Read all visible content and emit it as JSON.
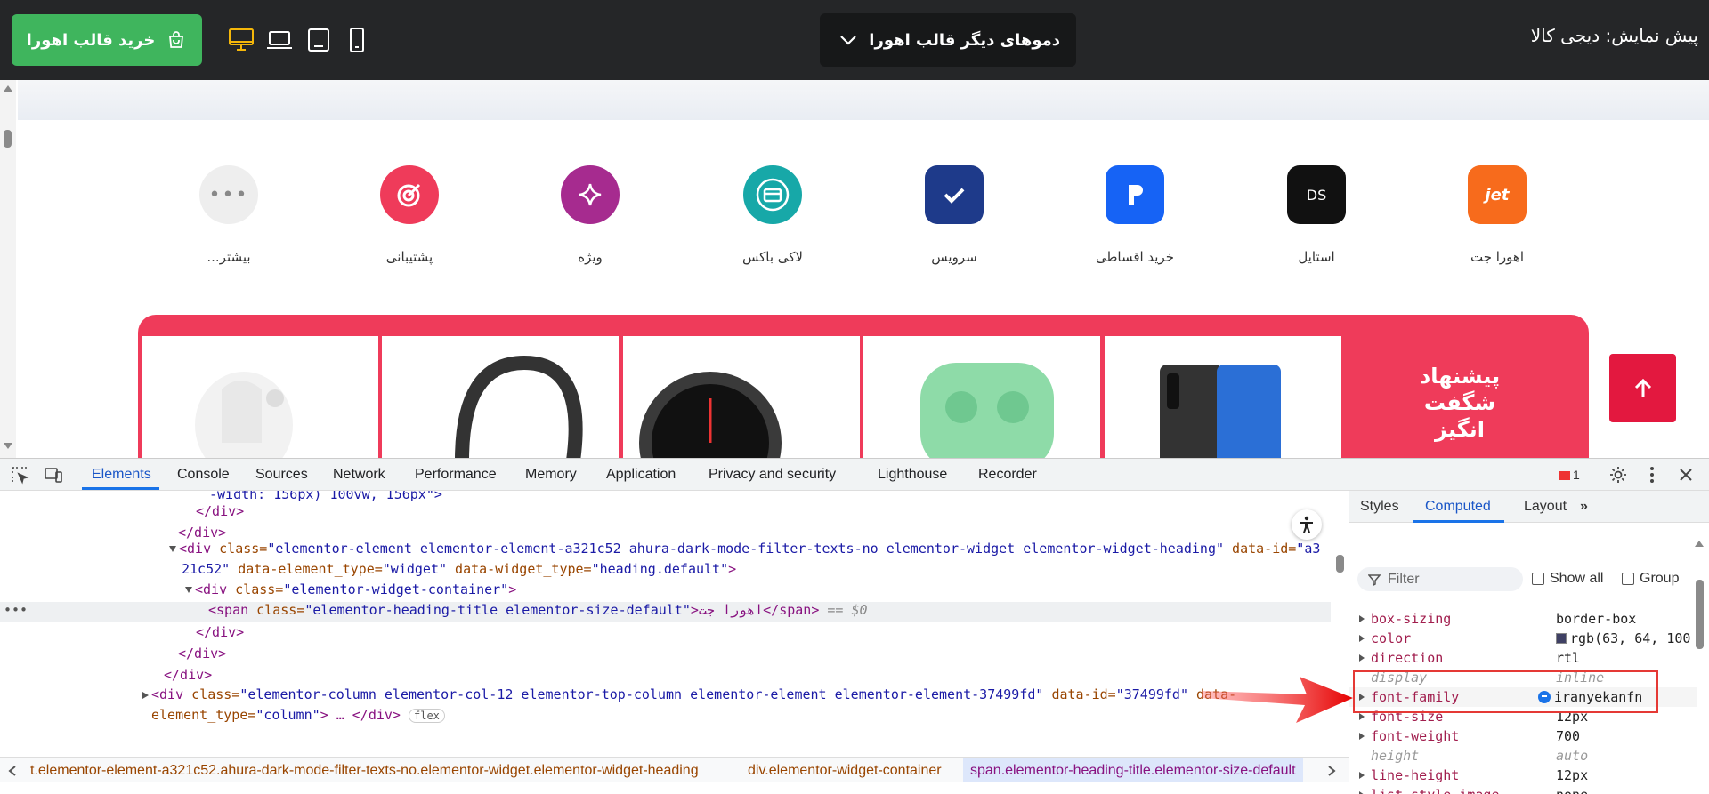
{
  "topbar": {
    "buy_button": "خرید قالب اهورا",
    "demo_select": "دموهای دیگر قالب اهورا",
    "preview_title": "پیش نمایش: دیجی کالا",
    "active_device": "desktop",
    "accent_color": "#3fb55d",
    "active_device_color": "#f5b70a"
  },
  "categories": [
    {
      "label": "اهورا جت",
      "icon": "jet-icon",
      "color": "#f76b1c",
      "text": "jet"
    },
    {
      "label": "استایل",
      "icon": "ds-style-icon",
      "color": "#111111",
      "text": "DS"
    },
    {
      "label": "خرید اقساطی",
      "icon": "installment-icon",
      "color": "#1663f5"
    },
    {
      "label": "سرویس",
      "icon": "check-icon",
      "color": "#1e3a8a"
    },
    {
      "label": "لاکی باکس",
      "icon": "lucky-box-icon",
      "color": "#17a8a8"
    },
    {
      "label": "ویژه",
      "icon": "sparkle-icon",
      "color": "#a62b8f"
    },
    {
      "label": "پشتیبانی",
      "icon": "target-icon",
      "color": "#ef3b5a"
    },
    {
      "label": "بیشتر...",
      "icon": "more-icon",
      "color": "#eeeeee"
    }
  ],
  "deal": {
    "title_lines": [
      "پیشنهاد",
      "شگفت",
      "انگیز"
    ],
    "color": "#ef3b5a"
  },
  "devtools": {
    "tabs": [
      "Elements",
      "Console",
      "Sources",
      "Network",
      "Performance",
      "Memory",
      "Application",
      "Privacy and security",
      "Lighthouse",
      "Recorder"
    ],
    "active_tab": "Elements",
    "error_count": "1",
    "dom": {
      "l1": "-width: 156px) 100vw, 156px\">",
      "l2": "</div>",
      "l3": "</div>",
      "l4_tag": "<div",
      "l4_attr1": " class=",
      "l4_val1": "\"elementor-element elementor-element-a321c52 ahura-dark-mode-filter-texts-no elementor-widget elementor-widget-heading\"",
      "l4_attr2": " data-id=",
      "l4_val2": "\"a3",
      "l5_val2": "21c52\"",
      "l5_attr3": " data-element_type=",
      "l5_val3": "\"widget\"",
      "l5_attr4": " data-widget_type=",
      "l5_val4": "\"heading.default\"",
      "l5_end": ">",
      "l6_tag": "<div",
      "l6_attr": " class=",
      "l6_val": "\"elementor-widget-container\"",
      "l6_end": ">",
      "l7_tag": "<span",
      "l7_attr": " class=",
      "l7_val": "\"elementor-heading-title elementor-size-default\"",
      "l7_text": ">اهورا جت</span>",
      "l7_marker": "== $0",
      "l8": "</div>",
      "l9": "</div>",
      "l10": "</div>",
      "l11_tag": "<div",
      "l11_attr1": " class=",
      "l11_val1": "\"elementor-column elementor-col-12 elementor-top-column elementor-element elementor-element-37499fd\"",
      "l11_attr2": " data-id=",
      "l11_val2": "\"37499fd\"",
      "l11_attr3": " data-",
      "l12_attr": "element_type=",
      "l12_val": "\"column\"",
      "l12_end": "> … </div>",
      "l12_badge": "flex"
    },
    "breadcrumbs": [
      "t.elementor-element-a321c52.ahura-dark-mode-filter-texts-no.elementor-widget.elementor-widget-heading",
      "div.elementor-widget-container",
      "span.elementor-heading-title.elementor-size-default"
    ],
    "side_tabs": [
      "Styles",
      "Computed",
      "Layout"
    ],
    "side_active": "Computed",
    "filter_placeholder": "Filter",
    "show_all": "Show all",
    "group": "Group",
    "props": [
      {
        "name": "box-sizing",
        "value": "border-box"
      },
      {
        "name": "color",
        "value": "rgb(63, 64, 100"
      },
      {
        "name": "direction",
        "value": "rtl"
      },
      {
        "name": "display",
        "value": "inline"
      },
      {
        "name": "font-family",
        "value": "iranyekanfn"
      },
      {
        "name": "font-size",
        "value": "12px"
      },
      {
        "name": "font-weight",
        "value": "700"
      },
      {
        "name": "height",
        "value": "auto"
      },
      {
        "name": "line-height",
        "value": "12px"
      },
      {
        "name": "list-style-image",
        "value": "none"
      }
    ],
    "color_swatch": "#3f4064"
  }
}
